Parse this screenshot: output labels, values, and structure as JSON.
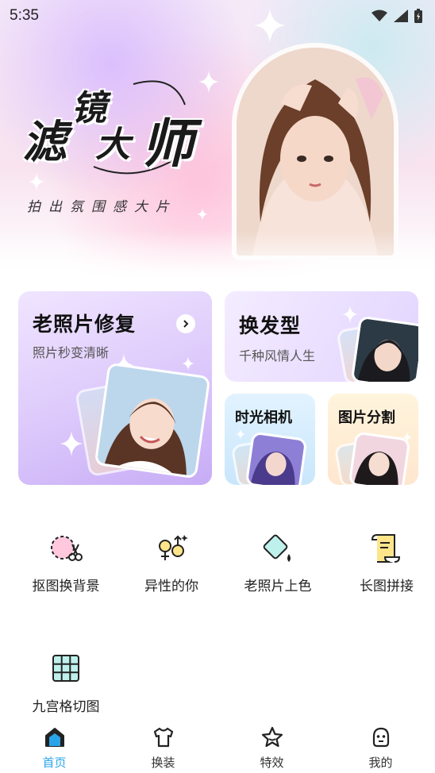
{
  "status_bar": {
    "time": "5:35"
  },
  "hero": {
    "title_chars": [
      "滤",
      "镜",
      "大",
      "师"
    ],
    "subtitle": "拍出氛围感大片"
  },
  "cards": {
    "old_photo": {
      "title": "老照片修复",
      "subtitle": "照片秒变清晰"
    },
    "hairstyle": {
      "title": "换发型",
      "subtitle": "千种风情人生"
    },
    "time_camera": {
      "title": "时光相机"
    },
    "photo_split": {
      "title": "图片分割"
    }
  },
  "tools": [
    {
      "label": "抠图换背景",
      "icon": "cutout-scissors-icon"
    },
    {
      "label": "异性的你",
      "icon": "gender-swap-icon"
    },
    {
      "label": "老照片上色",
      "icon": "paint-bucket-icon"
    },
    {
      "label": "长图拼接",
      "icon": "scroll-icon"
    },
    {
      "label": "九宫格切图",
      "icon": "grid-icon"
    }
  ],
  "nav": {
    "items": [
      {
        "label": "首页",
        "icon": "home-icon",
        "active": true
      },
      {
        "label": "换装",
        "icon": "tshirt-icon",
        "active": false
      },
      {
        "label": "特效",
        "icon": "star-icon",
        "active": false
      },
      {
        "label": "我的",
        "icon": "profile-icon",
        "active": false
      }
    ],
    "active_color": "#2aa4e8"
  }
}
